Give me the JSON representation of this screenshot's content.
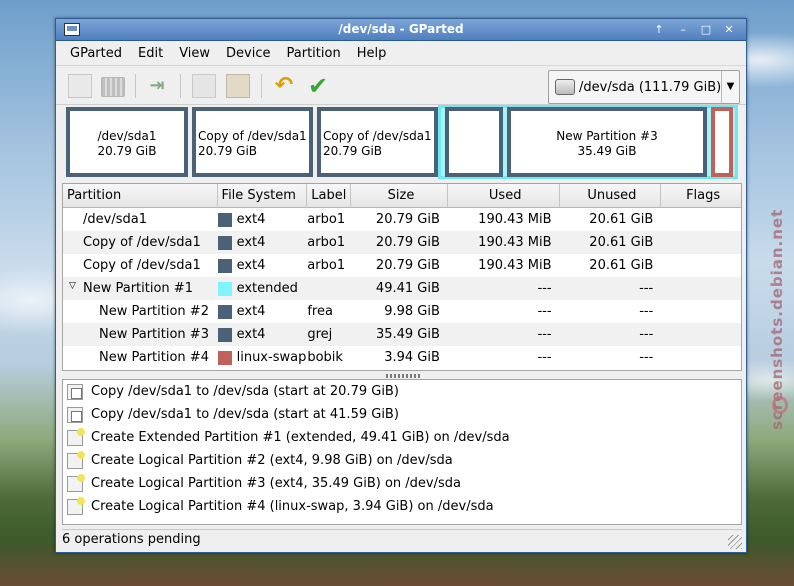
{
  "window": {
    "title": "/dev/sda - GParted",
    "controls": [
      "↑",
      "–",
      "□",
      "✕"
    ]
  },
  "menu": [
    "GParted",
    "Edit",
    "View",
    "Device",
    "Partition",
    "Help"
  ],
  "toolbar": {
    "device_label": "/dev/sda   (111.79 GiB)"
  },
  "visual": {
    "blocks": [
      {
        "line1": "/dev/sda1",
        "line2": "20.79 GiB"
      },
      {
        "line1": "Copy of /dev/sda1",
        "line2": "20.79 GiB"
      },
      {
        "line1": "Copy of /dev/sda1",
        "line2": "20.79 GiB"
      },
      {
        "line1": "",
        "line2": ""
      },
      {
        "line1": "New Partition #3",
        "line2": "35.49 GiB"
      }
    ]
  },
  "table": {
    "headers": [
      "Partition",
      "File System",
      "Label",
      "Size",
      "Used",
      "Unused",
      "Flags"
    ],
    "rows": [
      {
        "partition": "/dev/sda1",
        "fs": "ext4",
        "fs_color": "#4a6177",
        "label": "arbo1",
        "size": "20.79 GiB",
        "used": "190.43 MiB",
        "unused": "20.61 GiB",
        "flags": ""
      },
      {
        "partition": "Copy of /dev/sda1",
        "fs": "ext4",
        "fs_color": "#4a6177",
        "label": "arbo1",
        "size": "20.79 GiB",
        "used": "190.43 MiB",
        "unused": "20.61 GiB",
        "flags": ""
      },
      {
        "partition": "Copy of /dev/sda1",
        "fs": "ext4",
        "fs_color": "#4a6177",
        "label": "arbo1",
        "size": "20.79 GiB",
        "used": "190.43 MiB",
        "unused": "20.61 GiB",
        "flags": ""
      },
      {
        "partition": "New Partition #1",
        "fs": "extended",
        "fs_color": "#7ff5fb",
        "label": "",
        "size": "49.41 GiB",
        "used": "---",
        "unused": "---",
        "flags": ""
      },
      {
        "partition": "New Partition #2",
        "fs": "ext4",
        "fs_color": "#4a6177",
        "label": "frea",
        "size": "9.98 GiB",
        "used": "---",
        "unused": "---",
        "flags": ""
      },
      {
        "partition": "New Partition #3",
        "fs": "ext4",
        "fs_color": "#4a6177",
        "label": "grej",
        "size": "35.49 GiB",
        "used": "---",
        "unused": "---",
        "flags": ""
      },
      {
        "partition": "New Partition #4",
        "fs": "linux-swap",
        "fs_color": "#c0625a",
        "label": "bobik",
        "size": "3.94 GiB",
        "used": "---",
        "unused": "---",
        "flags": ""
      }
    ]
  },
  "operations": [
    {
      "icon": "copy",
      "text": "Copy /dev/sda1 to /dev/sda (start at 20.79 GiB)"
    },
    {
      "icon": "copy",
      "text": "Copy /dev/sda1 to /dev/sda (start at 41.59 GiB)"
    },
    {
      "icon": "new",
      "text": "Create Extended Partition #1 (extended, 49.41 GiB) on /dev/sda"
    },
    {
      "icon": "new",
      "text": "Create Logical Partition #2 (ext4, 9.98 GiB) on /dev/sda"
    },
    {
      "icon": "new",
      "text": "Create Logical Partition #3 (ext4, 35.49 GiB) on /dev/sda"
    },
    {
      "icon": "new",
      "text": "Create Logical Partition #4 (linux-swap, 3.94 GiB) on /dev/sda"
    }
  ],
  "status": "6 operations pending",
  "watermark": "screenshots.debian.net",
  "colors": {
    "ext4": "#4a6177",
    "extended": "#7ff5fb",
    "linux_swap": "#c0625a",
    "titlebar": "#5c88c6"
  }
}
